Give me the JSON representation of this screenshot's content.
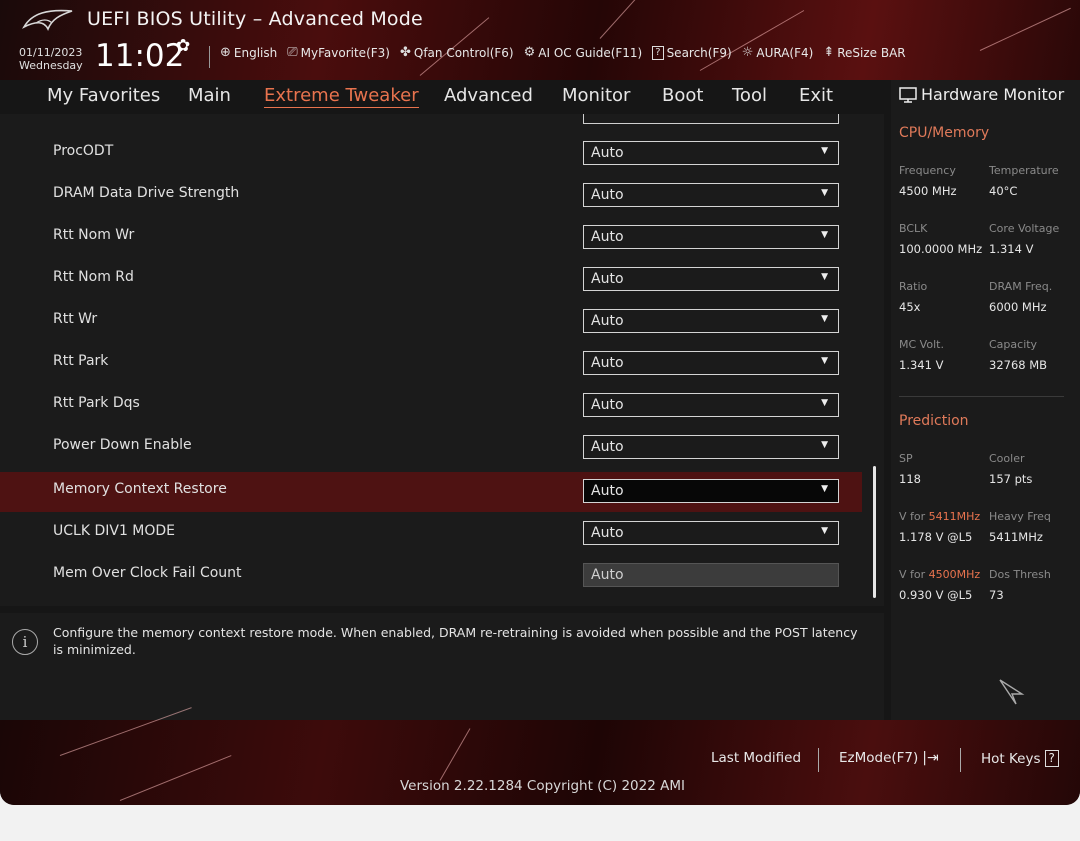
{
  "header": {
    "title": "UEFI BIOS Utility – Advanced Mode",
    "date": "01/11/2023",
    "weekday": "Wednesday",
    "time": "11:02",
    "toolbar": [
      {
        "label": "English",
        "icon": "globe-icon"
      },
      {
        "label": "MyFavorite(F3)",
        "icon": "favorite-icon"
      },
      {
        "label": "Qfan Control(F6)",
        "icon": "fan-icon"
      },
      {
        "label": "AI OC Guide(F11)",
        "icon": "ai-chip-icon"
      },
      {
        "label": "Search(F9)",
        "icon": "search-help-icon"
      },
      {
        "label": "AURA(F4)",
        "icon": "aura-light-icon"
      },
      {
        "label": "ReSize BAR",
        "icon": "resize-bar-icon"
      }
    ]
  },
  "nav": {
    "tabs": [
      "My Favorites",
      "Main",
      "Extreme Tweaker",
      "Advanced",
      "Monitor",
      "Boot",
      "Tool",
      "Exit"
    ],
    "active": "Extreme Tweaker"
  },
  "settings": [
    {
      "label": "ProcODT",
      "value": "Auto"
    },
    {
      "label": "DRAM Data Drive Strength",
      "value": "Auto"
    },
    {
      "label": "Rtt Nom Wr",
      "value": "Auto"
    },
    {
      "label": "Rtt Nom Rd",
      "value": "Auto"
    },
    {
      "label": "Rtt Wr",
      "value": "Auto"
    },
    {
      "label": "Rtt Park",
      "value": "Auto"
    },
    {
      "label": "Rtt Park Dqs",
      "value": "Auto"
    },
    {
      "label": "Power Down Enable",
      "value": "Auto"
    },
    {
      "label": "Memory Context Restore",
      "value": "Auto",
      "selected": true
    },
    {
      "label": "UCLK DIV1 MODE",
      "value": "Auto"
    },
    {
      "label": "Mem Over Clock Fail Count",
      "value": "Auto",
      "disabled": true
    }
  ],
  "help": {
    "text": "Configure the memory context restore mode. When enabled, DRAM re-retraining is avoided when possible and the POST latency is minimized."
  },
  "hardware_monitor": {
    "title": "Hardware Monitor",
    "cpu_memory": {
      "title": "CPU/Memory",
      "frequency_label": "Frequency",
      "frequency": "4500 MHz",
      "temperature_label": "Temperature",
      "temperature": "40°C",
      "bclk_label": "BCLK",
      "bclk": "100.0000 MHz",
      "core_voltage_label": "Core Voltage",
      "core_voltage": "1.314 V",
      "ratio_label": "Ratio",
      "ratio": "45x",
      "dram_freq_label": "DRAM Freq.",
      "dram_freq": "6000 MHz",
      "mc_volt_label": "MC Volt.",
      "mc_volt": "1.341 V",
      "capacity_label": "Capacity",
      "capacity": "32768 MB"
    },
    "prediction": {
      "title": "Prediction",
      "sp_label": "SP",
      "sp": "118",
      "cooler_label": "Cooler",
      "cooler": "157 pts",
      "vfor_prefix": "V for",
      "vfor1_freq": "5411MHz",
      "vfor1": "1.178 V @L5",
      "heavy_freq_label": "Heavy Freq",
      "heavy_freq": "5411MHz",
      "vfor2_freq": "4500MHz",
      "vfor2": "0.930 V @L5",
      "dos_thresh_label": "Dos Thresh",
      "dos_thresh": "73"
    }
  },
  "footer": {
    "last_modified": "Last Modified",
    "ezmode": "EzMode(F7)",
    "hotkeys": "Hot Keys",
    "hotkeys_icon": "?",
    "version": "Version 2.22.1284 Copyright (C) 2022 AMI"
  },
  "colors": {
    "accent": "#e8734e",
    "selected_row": "#4e1212",
    "background": "#1b1b1b"
  }
}
